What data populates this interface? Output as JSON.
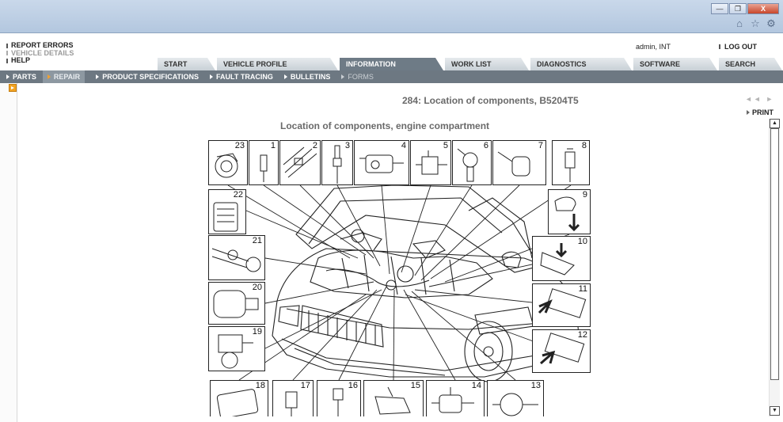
{
  "window": {
    "controls": [
      "minimize",
      "restore",
      "close"
    ],
    "close_label": "X",
    "tool_icons": [
      "home-icon",
      "star-icon",
      "gear-icon"
    ]
  },
  "header": {
    "left_links": [
      "REPORT ERRORS",
      "VEHICLE DETAILS",
      "HELP"
    ],
    "user": "admin, INT",
    "logout": "LOG OUT"
  },
  "tabs": [
    {
      "label": "START",
      "active": false
    },
    {
      "label": "VEHICLE PROFILE",
      "active": false
    },
    {
      "label": "INFORMATION",
      "active": true
    },
    {
      "label": "WORK LIST",
      "active": false
    },
    {
      "label": "DIAGNOSTICS",
      "active": false
    },
    {
      "label": "SOFTWARE",
      "active": false
    },
    {
      "label": "SEARCH",
      "active": false
    }
  ],
  "subnav": [
    {
      "label": "PARTS",
      "state": "normal"
    },
    {
      "label": "REPAIR",
      "state": "active"
    },
    {
      "label": "PRODUCT SPECIFICATIONS",
      "state": "normal"
    },
    {
      "label": "FAULT TRACING",
      "state": "normal"
    },
    {
      "label": "BULLETINS",
      "state": "normal"
    },
    {
      "label": "FORMS",
      "state": "dim"
    }
  ],
  "document": {
    "title": "284: Location of components, B5204T5",
    "pager": "◄◄ ►",
    "print": "PRINT",
    "figure_title": "Location of components, engine compartment"
  },
  "diagram": {
    "callouts": [
      "23",
      "1",
      "2",
      "3",
      "4",
      "5",
      "6",
      "7",
      "8",
      "22",
      "9",
      "21",
      "10",
      "20",
      "11",
      "19",
      "12",
      "18",
      "17",
      "16",
      "15",
      "14",
      "13"
    ]
  }
}
